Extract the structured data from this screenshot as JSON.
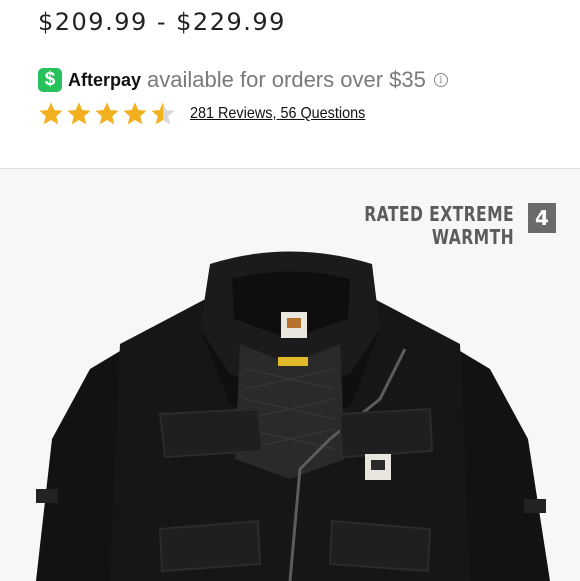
{
  "price": {
    "range": "$209.99 - $229.99"
  },
  "afterpay": {
    "badge": "$",
    "brand": "Afterpay",
    "text": "available for orders over $35",
    "info": "i"
  },
  "rating": {
    "value": 4.5,
    "max": 5,
    "reviews_link": "281 Reviews, 56 Questions"
  },
  "product_image": {
    "warmth_line1": "RATED EXTREME",
    "warmth_line2": "WARMTH",
    "warmth_level": "4"
  },
  "colors": {
    "star": "#f2b01e",
    "star_empty": "#d9d9d9",
    "afterpay_green": "#27c15b",
    "jacket": "#141414"
  }
}
